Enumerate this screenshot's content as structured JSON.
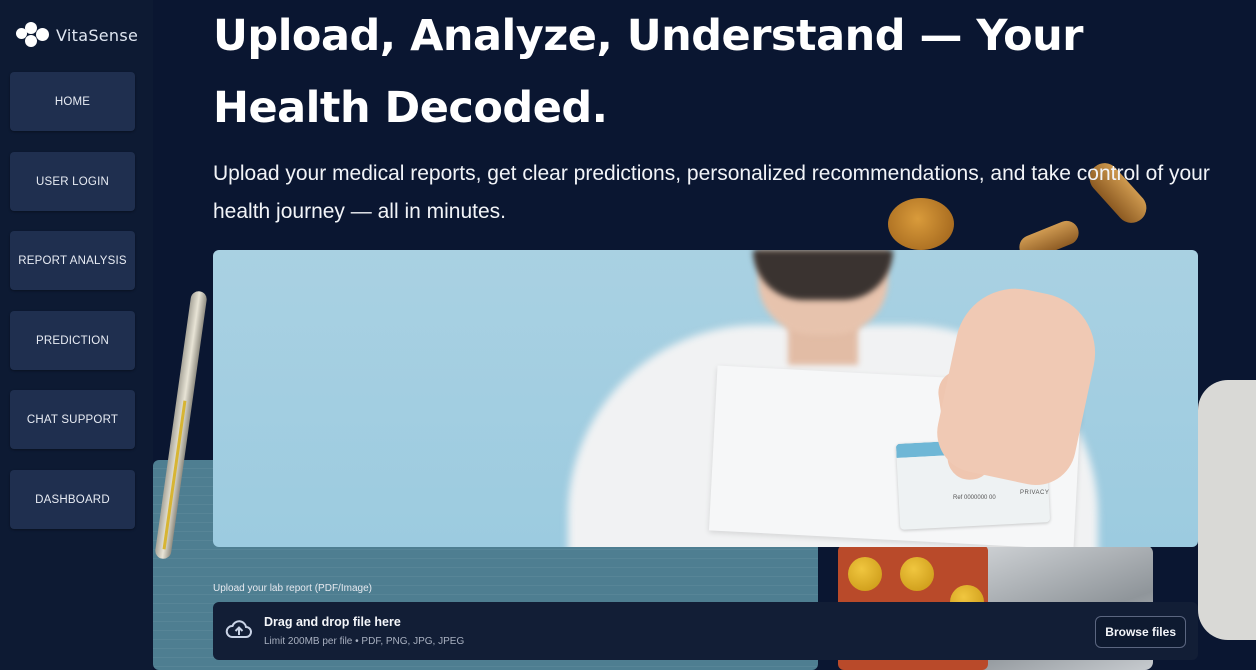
{
  "app": {
    "brand": "VitaSense"
  },
  "sidebar": {
    "items": [
      {
        "label": "HOME"
      },
      {
        "label": "USER LOGIN"
      },
      {
        "label": "REPORT ANALYSIS"
      },
      {
        "label": "PREDICTION"
      },
      {
        "label": "CHAT SUPPORT"
      },
      {
        "label": "DASHBOARD"
      }
    ]
  },
  "hero": {
    "headline": "Upload, Analyze, Understand — Your Health Decoded.",
    "subtitle": "Upload your medical reports, get clear predictions, personalized recommendations, and take control of your health journey — all in minutes.",
    "image_card_code": "Ref 0000000 00",
    "image_card_privacy": "PRIVACY"
  },
  "upload": {
    "label": "Upload your lab report (PDF/Image)",
    "dropzone_title": "Drag and drop file here",
    "dropzone_subtitle": "Limit 200MB per file • PDF, PNG, JPG, JPEG",
    "browse_label": "Browse files"
  },
  "icons": {
    "logo": "vitasense-logo-icon",
    "upload": "cloud-upload-icon"
  },
  "colors": {
    "background": "#0b1530",
    "sidebar_button": "#1f2f4f",
    "dropzone": "#121e36",
    "hero_sky": "#a9d1e2"
  }
}
